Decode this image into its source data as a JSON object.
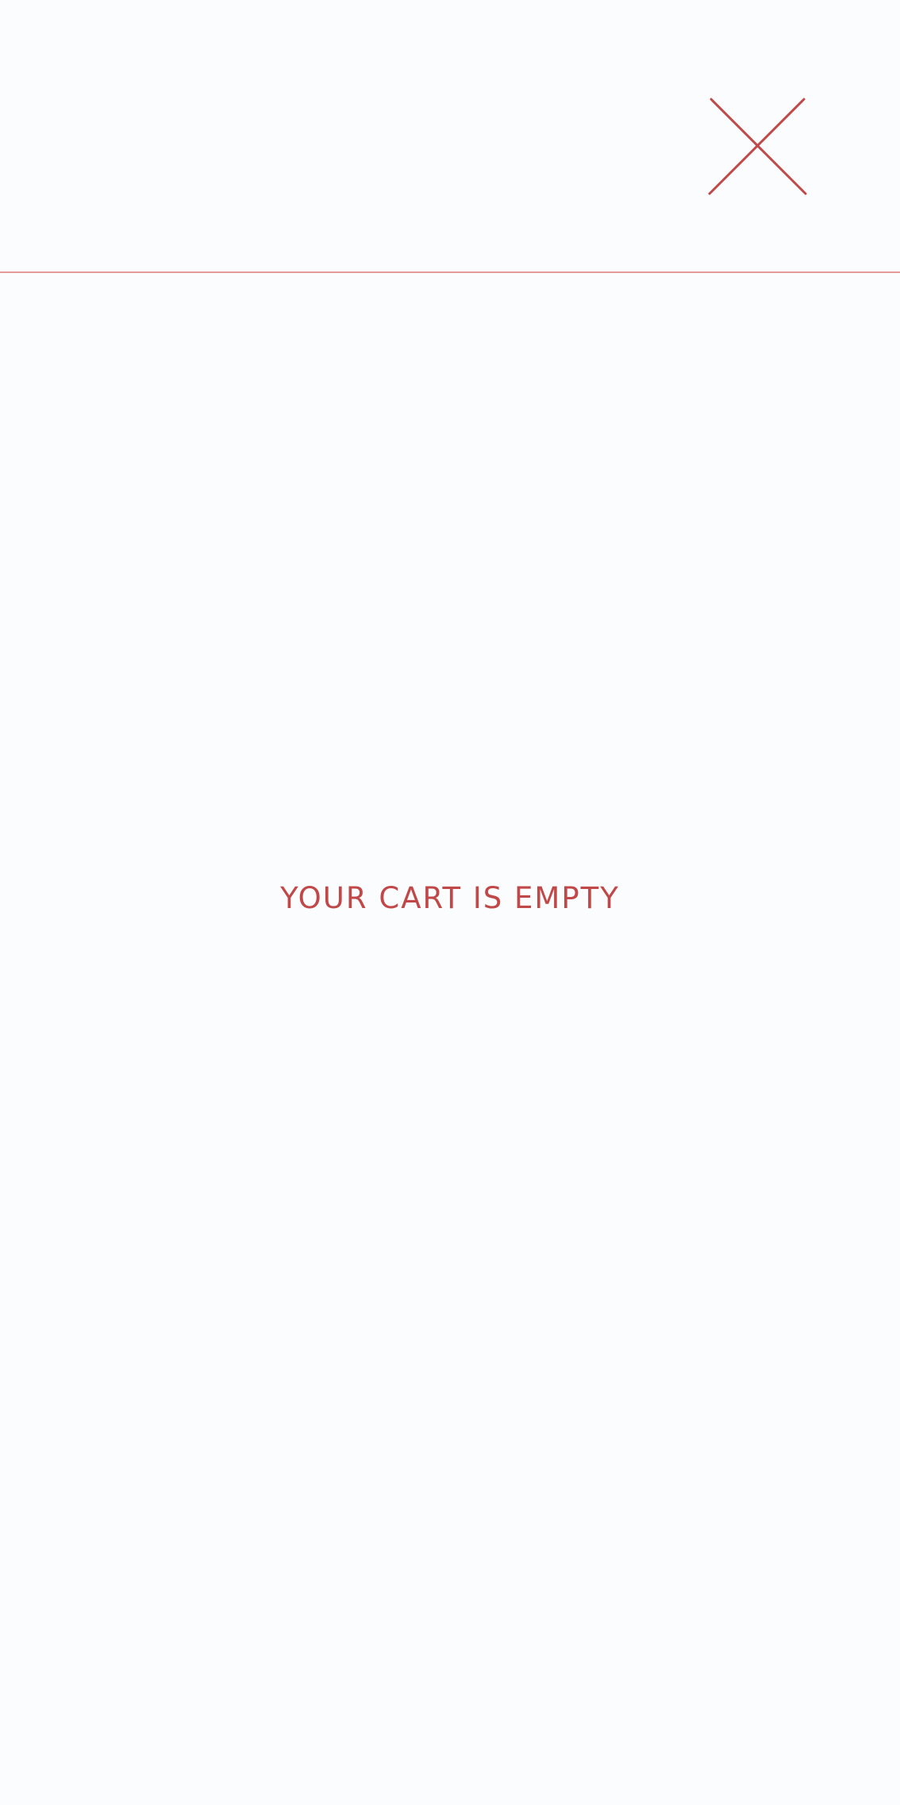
{
  "cart": {
    "empty_message": "YOUR CART IS EMPTY"
  },
  "header": {
    "close_icon": "close-icon"
  },
  "colors": {
    "background": "#fbfcfd",
    "accent": "#c04848",
    "divider": "#e39a9a"
  }
}
